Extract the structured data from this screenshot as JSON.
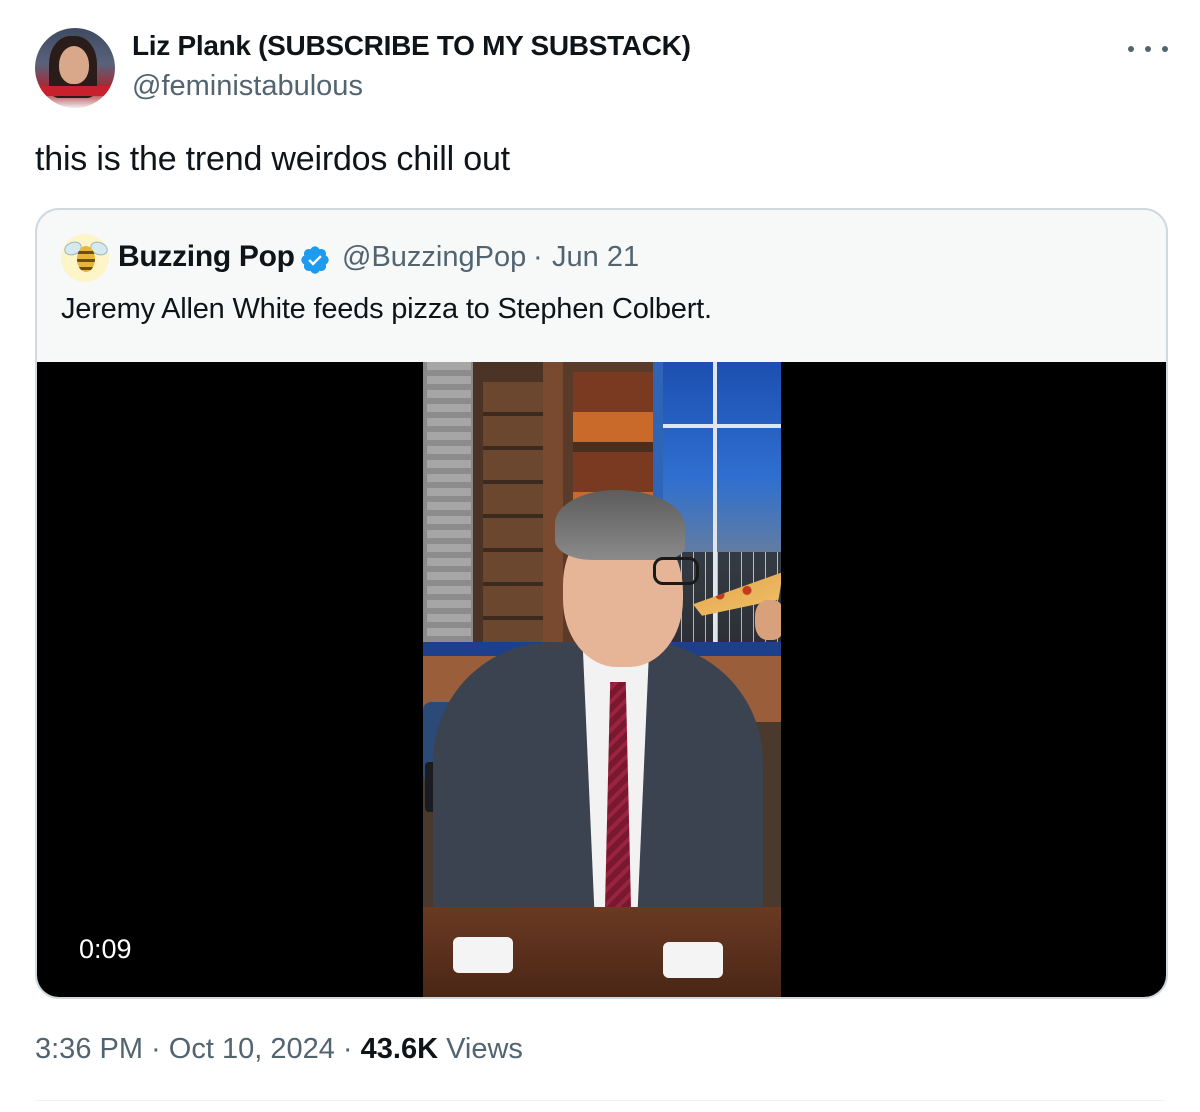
{
  "author": {
    "name": "Liz Plank (SUBSCRIBE TO MY SUBSTACK)",
    "handle": "@feministabulous",
    "avatar_icon": "profile-photo-icon"
  },
  "tweet": {
    "text": "this is the trend weirdos chill out",
    "more_icon": "more-options-icon"
  },
  "quote": {
    "name": "Buzzing Pop",
    "verified_icon": "verified-badge-icon",
    "verified_color": "#1d9bf0",
    "handle": "@BuzzingPop",
    "separator": "·",
    "date": "Jun 21",
    "text": "Jeremy Allen White feeds pizza to Stephen Colbert.",
    "video": {
      "duration": "0:09"
    }
  },
  "meta": {
    "time": "3:36 PM",
    "sep1": " · ",
    "date": "Oct 10, 2024",
    "sep2": " · ",
    "views_count": "43.6K",
    "views_label": " Views"
  }
}
